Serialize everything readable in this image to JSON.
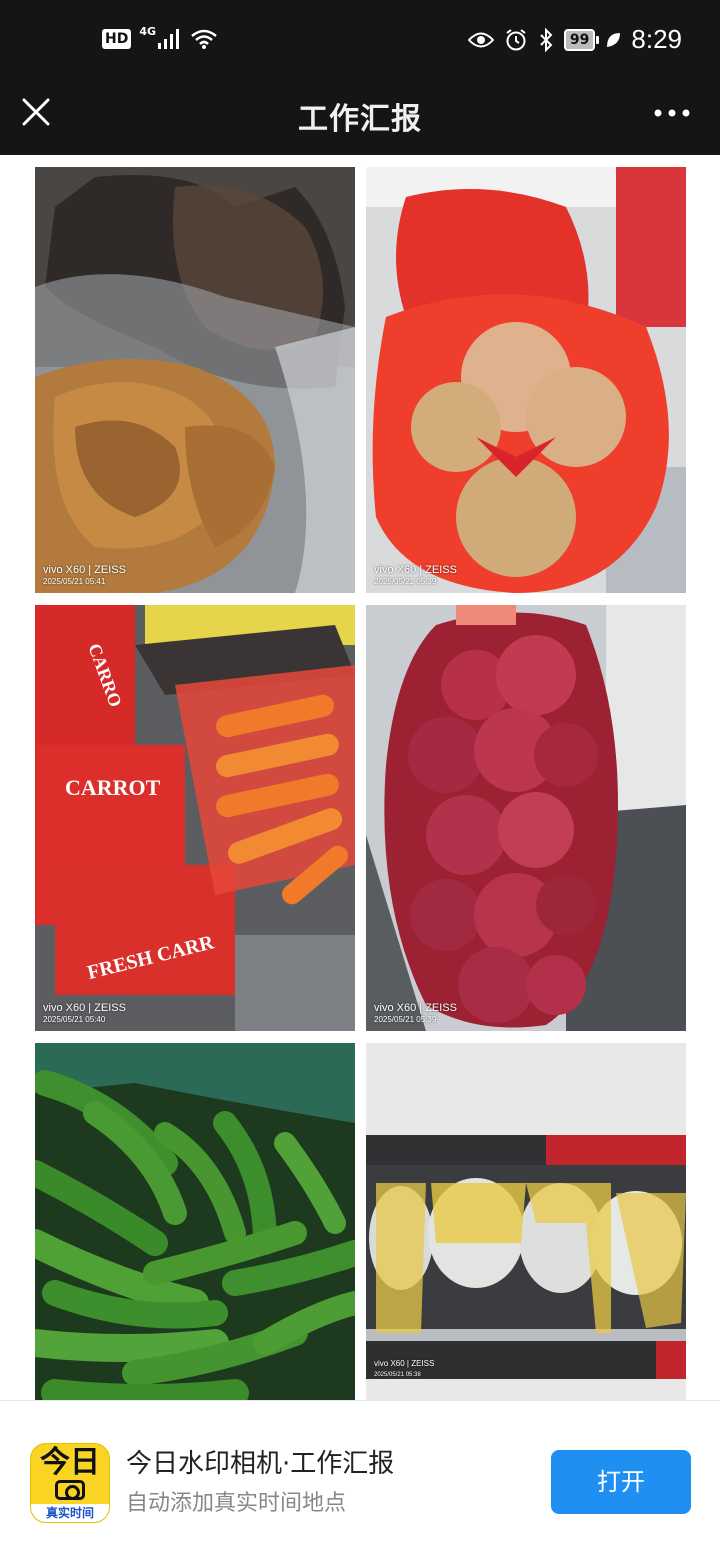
{
  "status_bar": {
    "hd": "HD",
    "network": "4G",
    "battery": "99",
    "time": "8:29",
    "icons": [
      "signal-icon",
      "wifi-icon",
      "eye-icon",
      "alarm-icon",
      "bluetooth-icon",
      "battery-icon",
      "leaf-icon"
    ]
  },
  "title_bar": {
    "title": "工作汇报",
    "close_icon": "close-icon",
    "more_icon": "more-icon"
  },
  "photos": [
    {
      "subject": "fried-tofu",
      "watermark_model": "vivo X60 | ZEISS",
      "watermark_time": "2025/05/21 05:41"
    },
    {
      "subject": "cabbage",
      "watermark_model": "vivo X60 | ZEISS",
      "watermark_time": "2025/05/21 05:39"
    },
    {
      "subject": "carrots",
      "watermark_model": "vivo X60 | ZEISS",
      "watermark_time": "2025/05/21 05:40"
    },
    {
      "subject": "onions",
      "watermark_model": "vivo X60 | ZEISS",
      "watermark_time": "2025/05/21 05:39"
    },
    {
      "subject": "green-peppers",
      "watermark_model": "",
      "watermark_time": ""
    },
    {
      "subject": "cauliflower",
      "watermark_model": "vivo X60 | ZEISS",
      "watermark_time": "2025/05/21 05:38"
    }
  ],
  "photo_text": {
    "carrot_box_1": "CARROT",
    "carrot_box_2": "FRESH CARR",
    "carrot_box_top": "CARRO"
  },
  "banner": {
    "app_icon_top": "今日",
    "app_icon_bottom": "真实时间",
    "title": "今日水印相机·工作汇报",
    "subtitle": "自动添加真实时间地点",
    "open_button": "打开"
  },
  "colors": {
    "header_bg": "#151515",
    "accent": "#1f8ff2",
    "app_icon_yellow": "#f9d422"
  }
}
